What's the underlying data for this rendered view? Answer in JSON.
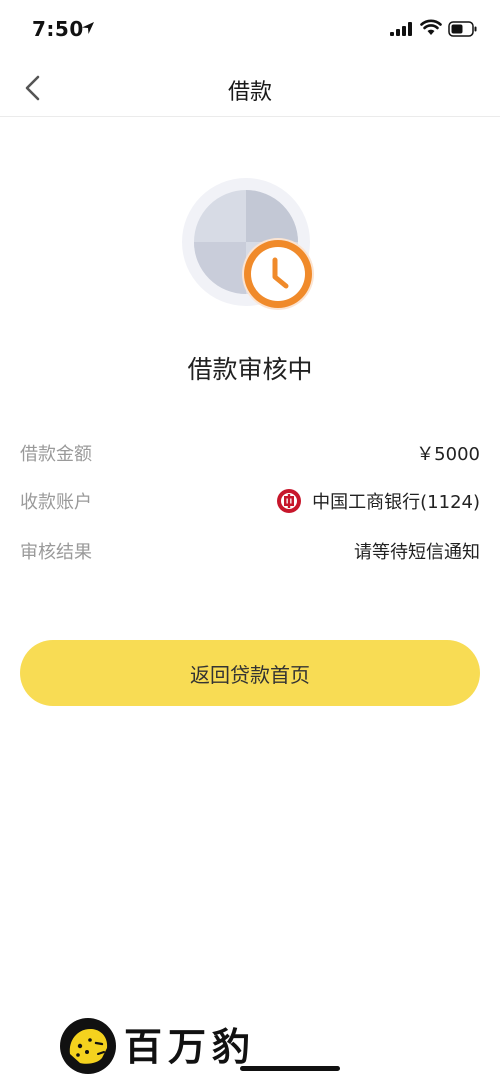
{
  "status_bar": {
    "time": "7:50",
    "icons": [
      "location-arrow-icon",
      "signal-icon",
      "wifi-icon",
      "battery-icon"
    ]
  },
  "nav": {
    "title": "借款",
    "back_icon": "chevron-left-icon"
  },
  "status": {
    "title": "借款审核中",
    "icon": "clock-icon"
  },
  "details": [
    {
      "label": "借款金额",
      "value": "￥5000"
    },
    {
      "label": "收款账户",
      "value": "中国工商银行(1124)",
      "icon": "icbc-logo-icon"
    },
    {
      "label": "审核结果",
      "value": "请等待短信通知"
    }
  ],
  "button": {
    "label": "返回贷款首页"
  },
  "watermark": {
    "text": "百万豹",
    "icon": "leopard-logo-icon"
  },
  "colors": {
    "accent": "#f8dc54",
    "clock_orange": "#f08a2a",
    "icbc_red": "#c7162b",
    "label_gray": "#9a9a9a"
  }
}
